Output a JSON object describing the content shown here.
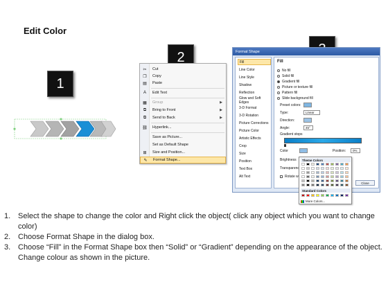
{
  "page": {
    "title": "Edit Color"
  },
  "badges": [
    "1",
    "2",
    "3"
  ],
  "context_menu": {
    "items": [
      {
        "label": "Cut",
        "icon": "scissors-icon",
        "disabled": false
      },
      {
        "label": "Copy",
        "icon": "copy-icon",
        "disabled": false
      },
      {
        "label": "Paste",
        "icon": "paste-icon",
        "disabled": false
      },
      {
        "label": "Edit Text",
        "icon": "edit-text-icon",
        "disabled": false
      },
      {
        "label": "Group",
        "icon": "group-icon",
        "disabled": true,
        "submenu": true
      },
      {
        "label": "Bring to Front",
        "icon": "bring-front-icon",
        "disabled": false,
        "submenu": true
      },
      {
        "label": "Send to Back",
        "icon": "send-back-icon",
        "disabled": false,
        "submenu": true
      },
      {
        "label": "Hyperlink...",
        "icon": "hyperlink-icon",
        "disabled": false
      },
      {
        "label": "Save as Picture...",
        "icon": "",
        "disabled": false
      },
      {
        "label": "Set as Default Shape",
        "icon": "",
        "disabled": false
      },
      {
        "label": "Size and Position...",
        "icon": "size-icon",
        "disabled": false
      },
      {
        "label": "Format Shape...",
        "icon": "format-shape-icon",
        "disabled": false,
        "highlighted": true
      }
    ]
  },
  "format_dialog": {
    "title": "Format Shape",
    "categories": [
      "Fill",
      "Line Color",
      "Line Style",
      "Shadow",
      "Reflection",
      "Glow and Soft Edges",
      "3-D Format",
      "3-D Rotation",
      "Picture Corrections",
      "Picture Color",
      "Artistic Effects",
      "Crop",
      "Size",
      "Position",
      "Text Box",
      "Alt Text"
    ],
    "fill_heading": "Fill",
    "fill_options": [
      "No fill",
      "Solid fill",
      "Gradient fill",
      "Picture or texture fill",
      "Pattern fill",
      "Slide background fill"
    ],
    "selected_fill": "Gradient fill",
    "preset_colors_label": "Preset colors:",
    "type_label": "Type:",
    "type_value": "Linear",
    "direction_label": "Direction:",
    "angle_label": "Angle:",
    "angle_value": "45°",
    "gradient_stops_label": "Gradient stops",
    "color_label": "Color",
    "position_label": "Position:",
    "position_value": "0%",
    "brightness_label": "Brightness",
    "transparency_label": "Transparency",
    "rotate_label": "Rotate with shape",
    "close_label": "Close"
  },
  "palette": {
    "theme_heading": "Theme Colors",
    "standard_heading": "Standard Colors",
    "more_label": "More Colors...",
    "theme_top": [
      "#ffffff",
      "#000000",
      "#eeece1",
      "#1f497d",
      "#4f81bd",
      "#c0504d",
      "#9bbb59",
      "#8064a2",
      "#4bacc6",
      "#f79646"
    ],
    "standard": [
      "#c00000",
      "#ff0000",
      "#ffc000",
      "#ffff00",
      "#92d050",
      "#00b050",
      "#00b0f0",
      "#0070c0",
      "#002060",
      "#7030a0"
    ]
  },
  "instructions": [
    {
      "num": "1.",
      "text": "Select the shape to change the color and Right click the object( click any object which you want to change color)"
    },
    {
      "num": "2.",
      "text": "Choose Format Shape in the dialog box."
    },
    {
      "num": "3.",
      "text": "Choose “Fill” in the Format Shape box then “Solid” or “Gradient” depending on the appearance of the object. Change colour as shown in the picture."
    }
  ],
  "colors": {
    "accent_blue": "#1a8fd6",
    "chevron_gray": "#9a9a9a",
    "highlight": "#fde7a8"
  }
}
